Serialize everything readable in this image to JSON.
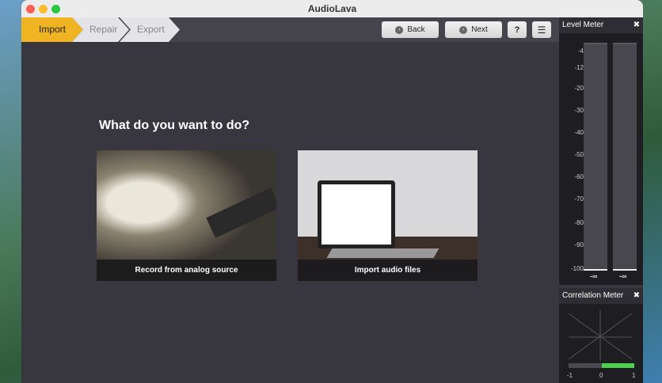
{
  "window": {
    "title": "AudioLava"
  },
  "steps": [
    {
      "label": "Import",
      "active": true
    },
    {
      "label": "Repair",
      "active": false
    },
    {
      "label": "Export",
      "active": false
    }
  ],
  "toolbar": {
    "back_label": "Back",
    "next_label": "Next",
    "help_label": "?"
  },
  "main": {
    "question": "What do you want to do?",
    "options": [
      {
        "label": "Record from analog source"
      },
      {
        "label": "Import audio files"
      }
    ]
  },
  "level_meter": {
    "title": "Level Meter",
    "scale": [
      "-4",
      "-12",
      "-20",
      "-30",
      "-40",
      "-50",
      "-60",
      "-70",
      "-80",
      "-90",
      "-100"
    ],
    "left_value": "-∞",
    "right_value": "-∞"
  },
  "correlation_meter": {
    "title": "Correlation Meter",
    "labels": [
      "-1",
      "0",
      "1"
    ],
    "value": 1.0,
    "bar_color": "#4cd14c"
  },
  "colors": {
    "accent": "#f0b322"
  }
}
